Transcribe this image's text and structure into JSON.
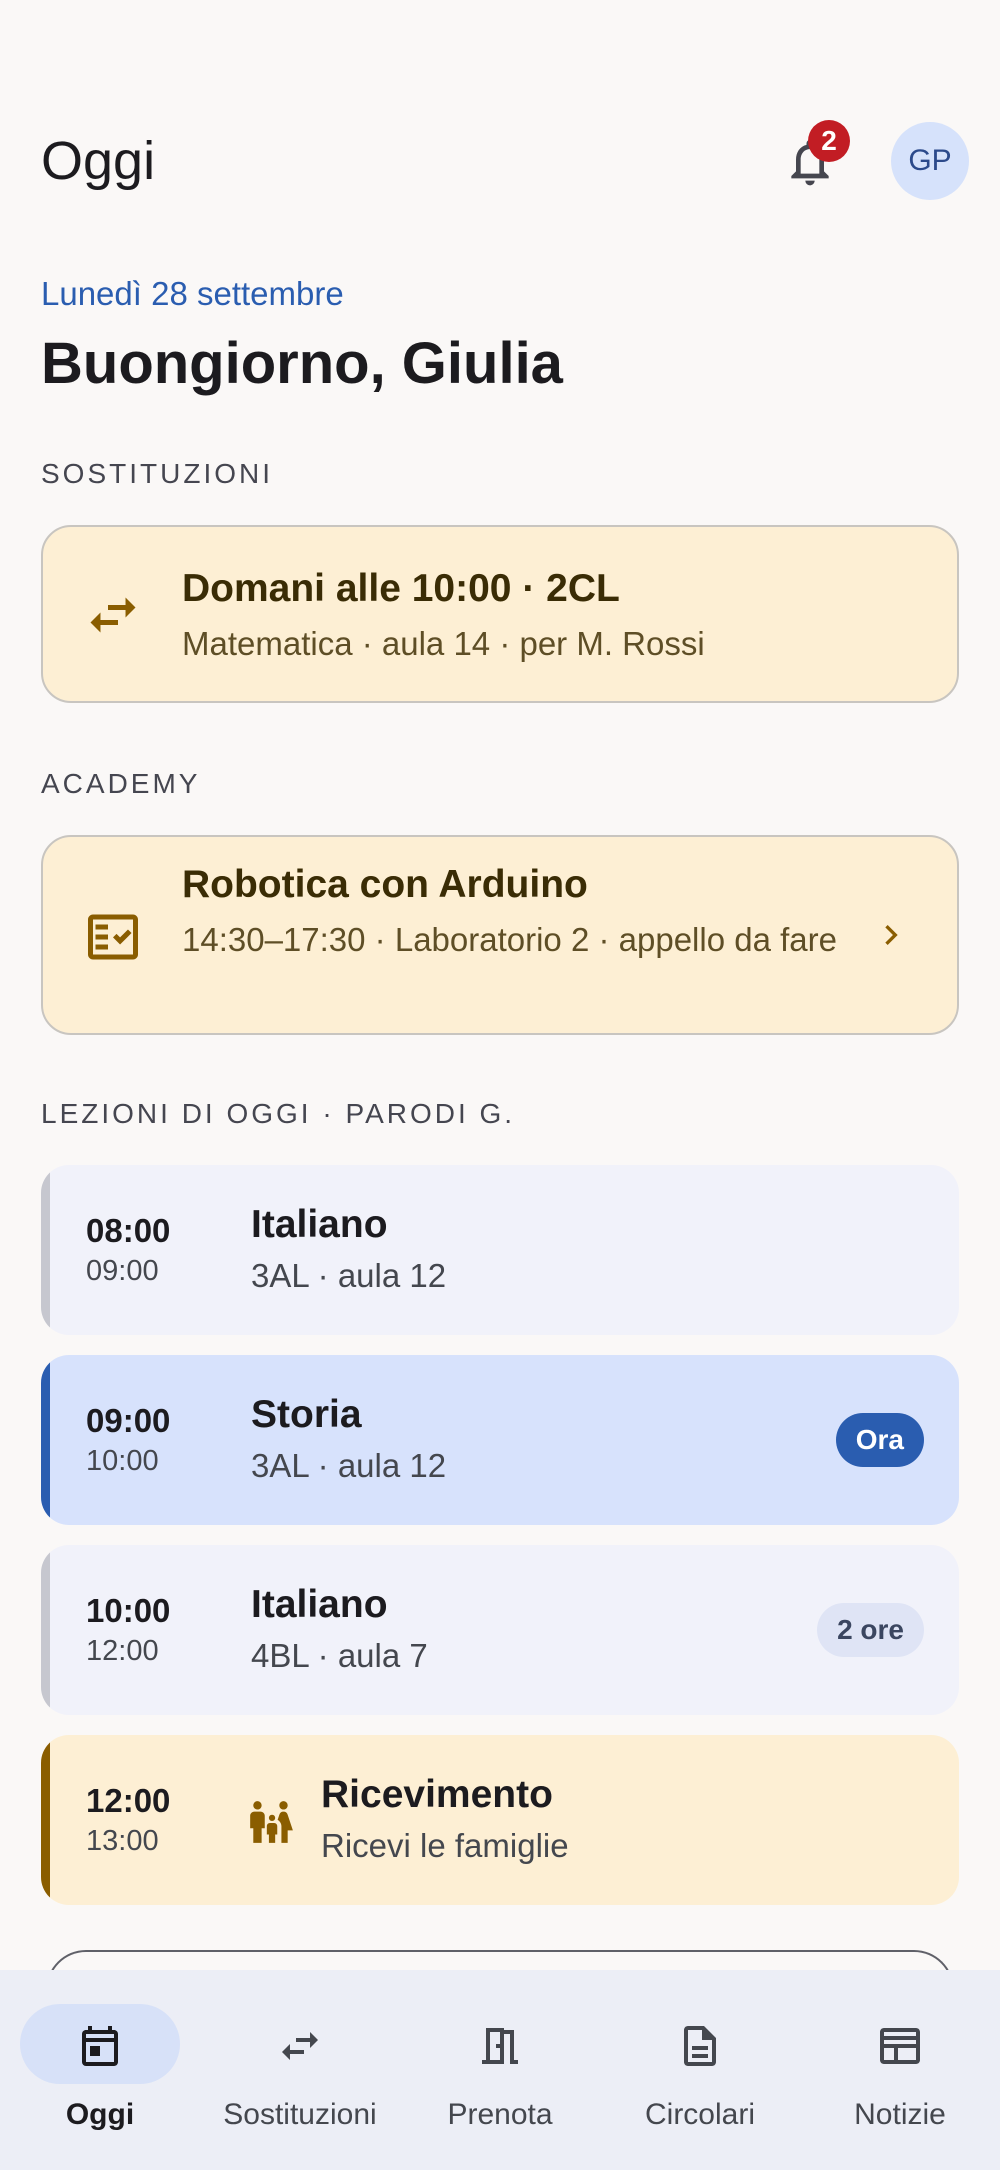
{
  "appbar": {
    "title": "Oggi",
    "notifications_count": "2",
    "avatar_initials": "GP"
  },
  "header": {
    "date": "Lunedì 28 settembre",
    "greeting": "Buongiorno, Giulia"
  },
  "sections": {
    "substitutions_label": "SOSTITUZIONI",
    "academy_label": "ACADEMY",
    "lessons_label": "LEZIONI DI OGGI · PARODI G."
  },
  "substitution_card": {
    "icon": "swap-icon",
    "title": "Domani alle 10:00 · 2CL",
    "subtitle": "Matematica · aula 14 · per M. Rossi"
  },
  "academy_card": {
    "icon": "checklist-icon",
    "title": "Robotica con Arduino",
    "subtitle": "14:30–17:30 · Laboratorio 2 · appello da fare"
  },
  "lessons": [
    {
      "start": "08:00",
      "end": "09:00",
      "subject": "Italiano",
      "info": "3AL · aula 12",
      "badge": ""
    },
    {
      "start": "09:00",
      "end": "10:00",
      "subject": "Storia",
      "info": "3AL · aula 12",
      "badge": "Ora"
    },
    {
      "start": "10:00",
      "end": "12:00",
      "subject": "Italiano",
      "info": "4BL · aula 7",
      "badge": "2 ore"
    },
    {
      "start": "12:00",
      "end": "13:00",
      "subject": "Ricevimento",
      "info": "Ricevi le famiglie",
      "badge": "",
      "icon": "family-icon"
    }
  ],
  "nav": [
    {
      "label": "Oggi",
      "icon": "calendar-icon",
      "active": true
    },
    {
      "label": "Sostituzioni",
      "icon": "swap-icon",
      "active": false
    },
    {
      "label": "Prenota",
      "icon": "door-icon",
      "active": false
    },
    {
      "label": "Circolari",
      "icon": "document-icon",
      "active": false
    },
    {
      "label": "Notizie",
      "icon": "newspaper-icon",
      "active": false
    }
  ],
  "colors": {
    "accent_blue": "#2a5db0",
    "current_lesson_bg": "#d7e2fc",
    "amber_card_bg": "#fdefd4",
    "amber_accent": "#8a5d00",
    "badge_red": "#c21d24"
  }
}
